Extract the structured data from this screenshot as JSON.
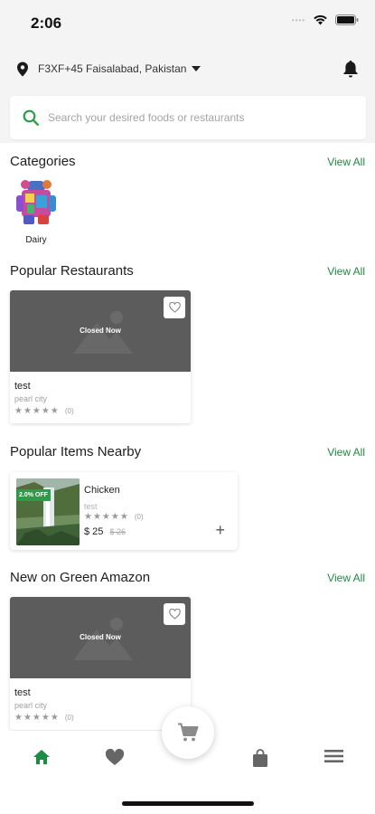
{
  "status": {
    "time": "2:06"
  },
  "location": {
    "text": "F3XF+45 Faisalabad, Pakistan"
  },
  "search": {
    "placeholder": "Search your desired foods or restaurants"
  },
  "categories": {
    "title": "Categories",
    "view_all": "View All",
    "items": [
      {
        "label": "Dairy"
      }
    ]
  },
  "popular_restaurants": {
    "title": "Popular Restaurants",
    "view_all": "View All",
    "items": [
      {
        "status": "Closed Now",
        "name": "test",
        "address": "pearl city",
        "rating_count": "(0)"
      }
    ]
  },
  "popular_items": {
    "title": "Popular Items Nearby",
    "view_all": "View All",
    "items": [
      {
        "discount": "2.0% OFF",
        "name": "Chicken",
        "restaurant": "test",
        "rating_count": "(0)",
        "price": "$ 25",
        "old_price": "$ 26"
      }
    ]
  },
  "new_on": {
    "title": "New on Green Amazon",
    "view_all": "View All",
    "items": [
      {
        "status": "Closed Now",
        "name": "test",
        "address": "pearl city",
        "rating_count": "(0)"
      }
    ]
  },
  "nav": {
    "items": [
      "home-icon",
      "heart-icon",
      "cart-icon",
      "bag-icon",
      "menu-icon"
    ]
  },
  "colors": {
    "accent": "#1f8a43",
    "badge": "#2e9b4a",
    "placeholder_gray": "#5c5c5c"
  }
}
